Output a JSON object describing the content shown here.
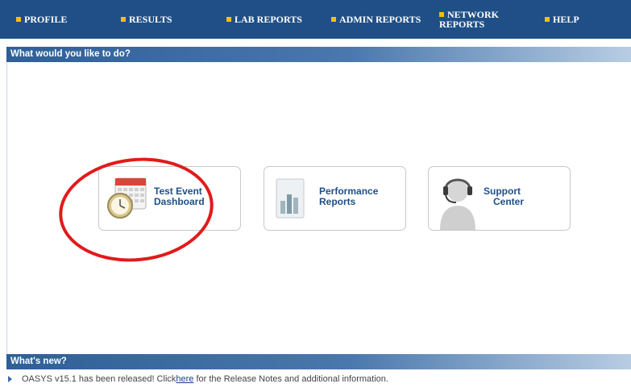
{
  "nav": {
    "items": [
      {
        "label": "PROFILE"
      },
      {
        "label": "RESULTS"
      },
      {
        "label": "LAB REPORTS"
      },
      {
        "label": "ADMIN REPORTS"
      },
      {
        "label_line1": "NETWORK",
        "label_line2": "REPORTS"
      },
      {
        "label": "HELP"
      }
    ],
    "bullet_color": "#f2c200",
    "background": "#1f4f86"
  },
  "main": {
    "heading": "What would you like to do?",
    "cards": [
      {
        "line1": "Test Event",
        "line2": "Dashboard",
        "icon": "calendar-clock-icon"
      },
      {
        "line1": "Performance",
        "line2": "Reports",
        "icon": "bar-chart-document-icon"
      },
      {
        "line1": "Support",
        "line2": "Center",
        "icon": "headset-person-icon"
      }
    ]
  },
  "news": {
    "heading": "What's new?",
    "text_before": "OASYS v15.1 has been released! Click ",
    "link": "here",
    "text_after": " for the Release Notes and additional information."
  },
  "annotation": {
    "color": "#e01b1b"
  }
}
